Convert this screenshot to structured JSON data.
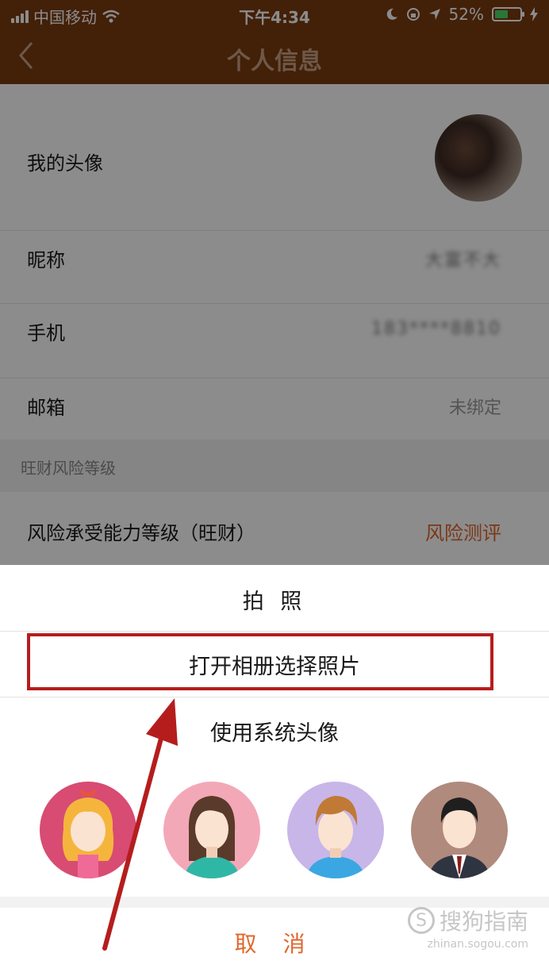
{
  "status_bar": {
    "carrier": "中国移动",
    "time": "下午4:34",
    "battery": "52%",
    "battery_level": 0.52
  },
  "nav": {
    "title": "个人信息"
  },
  "profile": {
    "avatar_label": "我的头像",
    "nickname_label": "昵称",
    "nickname_value": "大富不大",
    "phone_label": "手机",
    "phone_value": "183****8810",
    "email_label": "邮箱",
    "email_value": "未绑定",
    "section_title": "旺财风险等级",
    "risk_label": "风险承受能力等级（旺财）",
    "risk_link": "风险测评"
  },
  "action_sheet": {
    "take_photo": "拍 照",
    "open_album": "打开相册选择照片",
    "use_system_avatar": "使用系统头像",
    "cancel": "取 消"
  },
  "system_avatars": [
    "girl-avatar-icon",
    "woman-avatar-icon",
    "boy-avatar-icon",
    "man-avatar-icon"
  ],
  "watermark": {
    "main": "搜狗指南",
    "sub": "zhinan.sogou.com"
  },
  "colors": {
    "header": "#7a3b10",
    "accent": "#e0662a",
    "highlight": "#b51d1d"
  }
}
